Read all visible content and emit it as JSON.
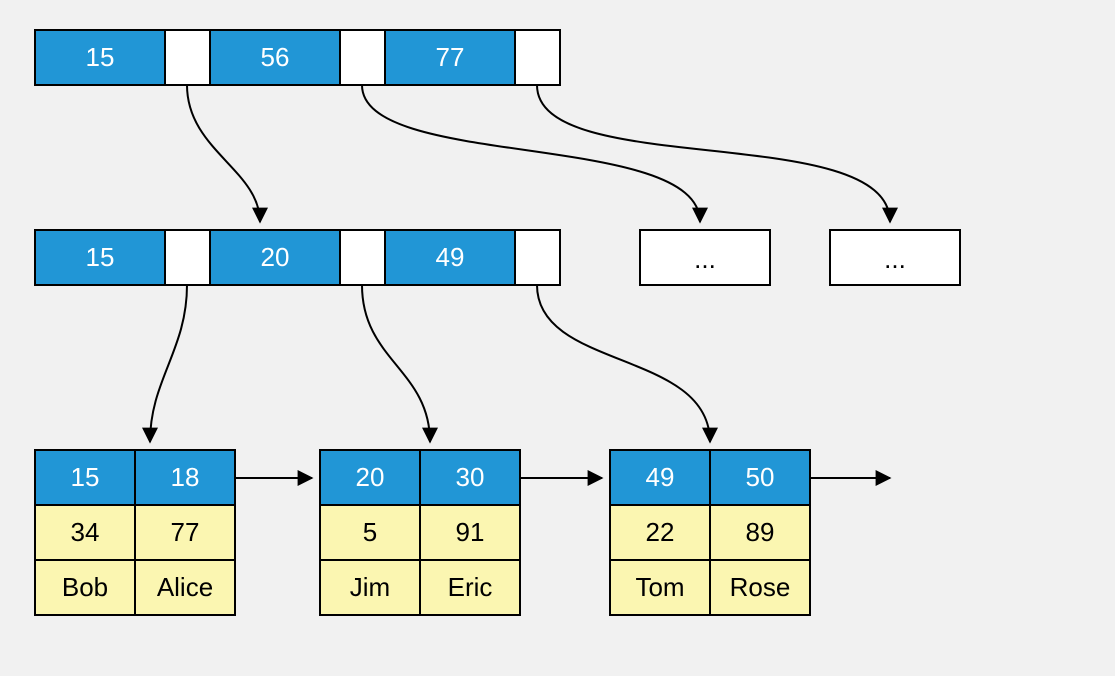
{
  "diagram_type": "b-plus-tree-index",
  "colors": {
    "key": "#2196d6",
    "pointer": "#ffffff",
    "data": "#fbf6b1",
    "stroke": "#000000"
  },
  "root": {
    "keys": [
      "15",
      "56",
      "77"
    ],
    "pointers": 3
  },
  "internal": {
    "keys": [
      "15",
      "20",
      "49"
    ],
    "pointers": 3
  },
  "stub_nodes": [
    "...",
    "..."
  ],
  "leaves": [
    {
      "keys": [
        "15",
        "18"
      ],
      "rows": [
        [
          "34",
          "77"
        ],
        [
          "Bob",
          "Alice"
        ]
      ]
    },
    {
      "keys": [
        "20",
        "30"
      ],
      "rows": [
        [
          "5",
          "91"
        ],
        [
          "Jim",
          "Eric"
        ]
      ]
    },
    {
      "keys": [
        "49",
        "50"
      ],
      "rows": [
        [
          "22",
          "89"
        ],
        [
          "Tom",
          "Rose"
        ]
      ]
    }
  ]
}
